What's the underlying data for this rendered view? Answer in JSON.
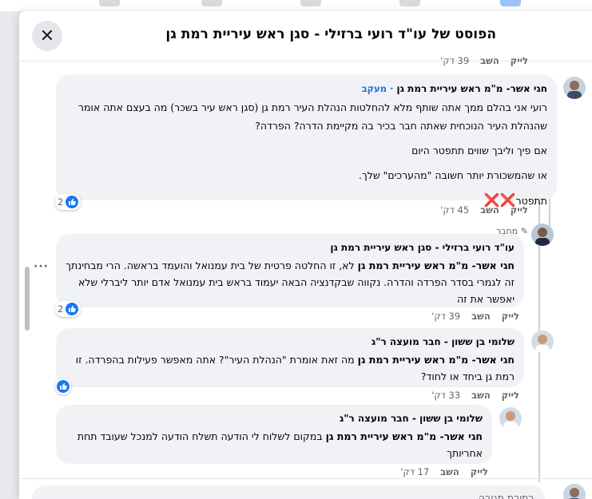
{
  "dialog": {
    "title": "הפוסט של עו\"ד רועי ברזילי - סגן ראש עיריית רמת גן",
    "close_icon": "close-icon"
  },
  "top_actions": {
    "like": "לייק",
    "reply": "השב",
    "time": "39 דק'"
  },
  "comments": [
    {
      "author": "חגי אשר- מ\"מ ראש עיריית רמת גן",
      "badge": "מעקב",
      "paragraphs": [
        "רועי אני בהלם ממך אתה שותף מלא להחלטות הנהלת העיר רמת גן (סגן ראש עיר בשכר) מה בעצם אתה אומר שהנהלת העיר הנוכחית שאתה חבר בכיר בה מקיימת הדרה? הפרדה?",
        "אם פיך וליבך שווים תתפטר היום",
        "או שהמשכורת יותר חשובה \"מהערכים\" שלך.",
        "תתפטר"
      ],
      "emoji": "❌❌",
      "reactions": "2",
      "like": "לייק",
      "reply": "השב",
      "time": "45 דק'"
    },
    {
      "author_tag": "מחבר",
      "author": "עו\"ד רועי ברזילי - סגן ראש עיריית רמת גן",
      "mention": "חגי אשר- מ\"מ ראש עיריית רמת גן",
      "text": " לא, זו החלטה פרטית של בית עמנואל והועמד בראשה. הרי מבחינתך זה לגמרי בסדר הפרדה והדרה. נקווה שבקדנציה הבאה יעמוד בראש בית עמנואל אדם יותר ליברלי שלא יאפשר את זה",
      "reactions": "2",
      "like": "לייק",
      "reply": "השב",
      "time": "39 דק'"
    },
    {
      "author": "שלומי בן ששון - חבר מועצה ר\"ג",
      "mention": "חגי אשר- מ\"מ ראש עיריית רמת גן",
      "text": " מה זאת אומרת \"הנהלת העיר\"? אתה מאפשר פעילות בהפרדה. זו רמת גן ביחד או לחוד?",
      "like": "לייק",
      "reply": "השב",
      "time": "33 דק'"
    },
    {
      "author": "שלומי בן ששון - חבר מועצה ר\"ג",
      "mention": "חגי אשר- מ\"מ ראש עיריית רמת גן",
      "text": " במקום לשלוח לי הודעה תשלח הודעה למנכל שעובד תחת אחריותך",
      "like": "לייק",
      "reply": "השב",
      "time": "17 דק'"
    }
  ],
  "composer": {
    "placeholder": "כתיבת תגובה..."
  },
  "colors": {
    "accent": "#1877f2",
    "bubble": "#f0f2f5",
    "badge": "#216fdb"
  },
  "icons": [
    "like-icon",
    "pencil-icon",
    "more-icon",
    "avatar"
  ]
}
